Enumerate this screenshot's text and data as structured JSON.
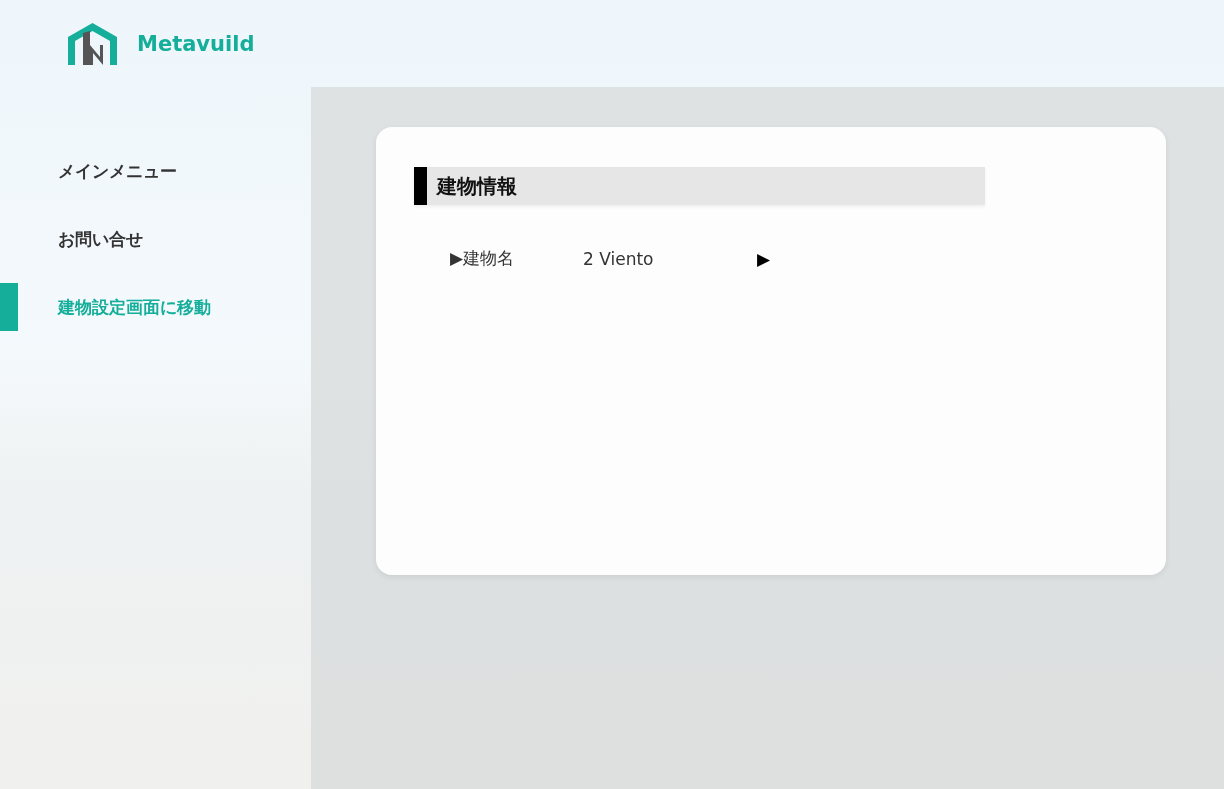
{
  "header": {
    "logo_text": "Metavuild"
  },
  "sidebar": {
    "items": [
      {
        "label": "メインメニュー",
        "selected": false
      },
      {
        "label": "お問い合せ",
        "selected": false
      },
      {
        "label": "建物設定画面に移動",
        "selected": true
      }
    ]
  },
  "card": {
    "title": "建物情報",
    "rows": [
      {
        "label": "▶建物名",
        "value": "2 Viento",
        "marker": "▶"
      }
    ]
  }
}
